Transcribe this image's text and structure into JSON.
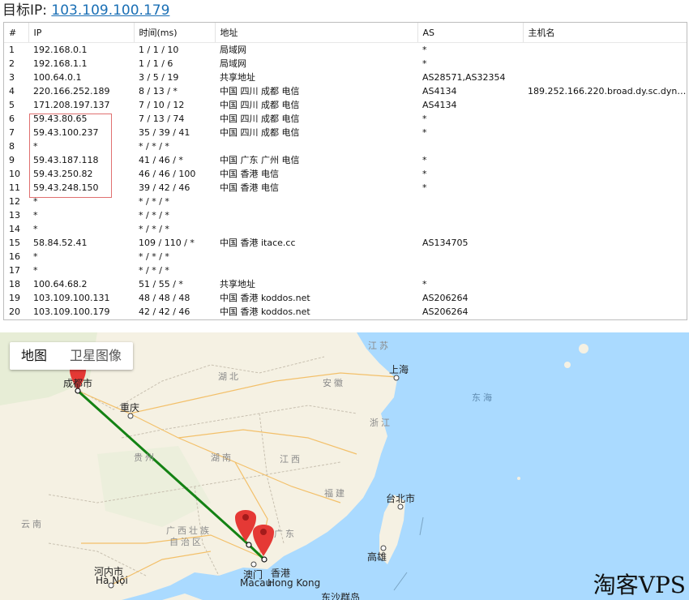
{
  "header": {
    "label": "目标IP:",
    "ip": "103.109.100.179"
  },
  "table": {
    "columns": [
      "#",
      "IP",
      "时间(ms)",
      "地址",
      "AS",
      "主机名"
    ],
    "rows": [
      {
        "n": "1",
        "ip": "192.168.0.1",
        "time": "1 / 1 / 10",
        "addr": "局域网",
        "as": "*",
        "host": ""
      },
      {
        "n": "2",
        "ip": "192.168.1.1",
        "time": "1 / 1 / 6",
        "addr": "局域网",
        "as": "*",
        "host": ""
      },
      {
        "n": "3",
        "ip": "100.64.0.1",
        "time": "3 / 5 / 19",
        "addr": "共享地址",
        "as": "AS28571,AS32354",
        "host": ""
      },
      {
        "n": "4",
        "ip": "220.166.252.189",
        "time": "8 / 13 / *",
        "addr": "中国 四川 成都 电信",
        "as": "AS4134",
        "host": "189.252.166.220.broad.dy.sc.dyna..."
      },
      {
        "n": "5",
        "ip": "171.208.197.137",
        "time": "7 / 10 / 12",
        "addr": "中国 四川 成都 电信",
        "as": "AS4134",
        "host": ""
      },
      {
        "n": "6",
        "ip": "59.43.80.65",
        "time": "7 / 13 / 74",
        "addr": "中国 四川 成都 电信",
        "as": "*",
        "host": ""
      },
      {
        "n": "7",
        "ip": "59.43.100.237",
        "time": "35 / 39 / 41",
        "addr": "中国 四川 成都 电信",
        "as": "*",
        "host": ""
      },
      {
        "n": "8",
        "ip": "*",
        "time": "* / * / *",
        "addr": "",
        "as": "",
        "host": ""
      },
      {
        "n": "9",
        "ip": "59.43.187.118",
        "time": "41 / 46 / *",
        "addr": "中国 广东 广州 电信",
        "as": "*",
        "host": ""
      },
      {
        "n": "10",
        "ip": "59.43.250.82",
        "time": "46 / 46 / 100",
        "addr": "中国 香港 电信",
        "as": "*",
        "host": ""
      },
      {
        "n": "11",
        "ip": "59.43.248.150",
        "time": "39 / 42 / 46",
        "addr": "中国 香港 电信",
        "as": "*",
        "host": ""
      },
      {
        "n": "12",
        "ip": "*",
        "time": "* / * / *",
        "addr": "",
        "as": "",
        "host": ""
      },
      {
        "n": "13",
        "ip": "*",
        "time": "* / * / *",
        "addr": "",
        "as": "",
        "host": ""
      },
      {
        "n": "14",
        "ip": "*",
        "time": "* / * / *",
        "addr": "",
        "as": "",
        "host": ""
      },
      {
        "n": "15",
        "ip": "58.84.52.41",
        "time": "109 / 110 / *",
        "addr": "中国 香港 itace.cc",
        "as": "AS134705",
        "host": ""
      },
      {
        "n": "16",
        "ip": "*",
        "time": "* / * / *",
        "addr": "",
        "as": "",
        "host": ""
      },
      {
        "n": "17",
        "ip": "*",
        "time": "* / * / *",
        "addr": "",
        "as": "",
        "host": ""
      },
      {
        "n": "18",
        "ip": "100.64.68.2",
        "time": "51 / 55 / *",
        "addr": "共享地址",
        "as": "*",
        "host": ""
      },
      {
        "n": "19",
        "ip": "103.109.100.131",
        "time": "48 / 48 / 48",
        "addr": "中国 香港 koddos.net",
        "as": "AS206264",
        "host": ""
      },
      {
        "n": "20",
        "ip": "103.109.100.179",
        "time": "42 / 42 / 46",
        "addr": "中国 香港 koddos.net",
        "as": "AS206264",
        "host": ""
      }
    ]
  },
  "map": {
    "type_control": {
      "map": "地图",
      "satellite": "卫星图像"
    },
    "provinces": [
      "江苏",
      "湖北",
      "安徽",
      "浙江",
      "湖南",
      "江西",
      "贵州",
      "福建",
      "广西壮族",
      "自治区",
      "广东",
      "云南"
    ],
    "seas": [
      "东海"
    ],
    "cities": [
      "成都市",
      "重庆",
      "上海",
      "台北市",
      "高雄",
      "澳门",
      "Macau",
      "香港",
      "Hong Kong",
      "河内市",
      "Hà Nội",
      "东沙群岛"
    ],
    "route_color": "#148214",
    "marker_color": "#e53935"
  },
  "watermark": "淘客VPS"
}
